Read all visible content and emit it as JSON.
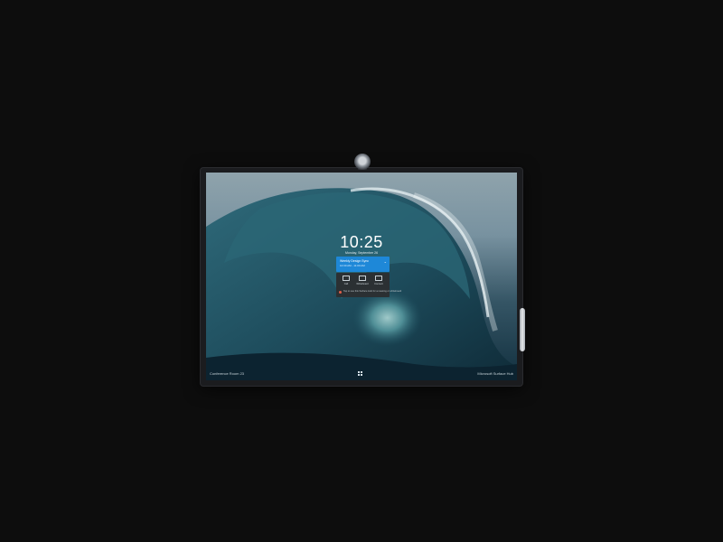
{
  "lock_screen": {
    "time": "10:25",
    "date": "Monday, September 26",
    "meeting": {
      "title": "Weekly Design Sync",
      "time": "10:30 AM - 11:00 AM"
    },
    "actions": [
      {
        "label": "Call",
        "icon": "camera-icon"
      },
      {
        "label": "Whiteboard",
        "icon": "whiteboard-icon"
      },
      {
        "label": "Connect",
        "icon": "connect-icon"
      }
    ],
    "tip": "Tap to use this Surface Hub for a meeting or whiteboard",
    "room_name": "Conference Room 23",
    "brand": "Microsoft Surface Hub"
  },
  "colors": {
    "meeting_card": "#1e88d8",
    "panel": "#2b3033",
    "background": "#0d0d0d"
  }
}
